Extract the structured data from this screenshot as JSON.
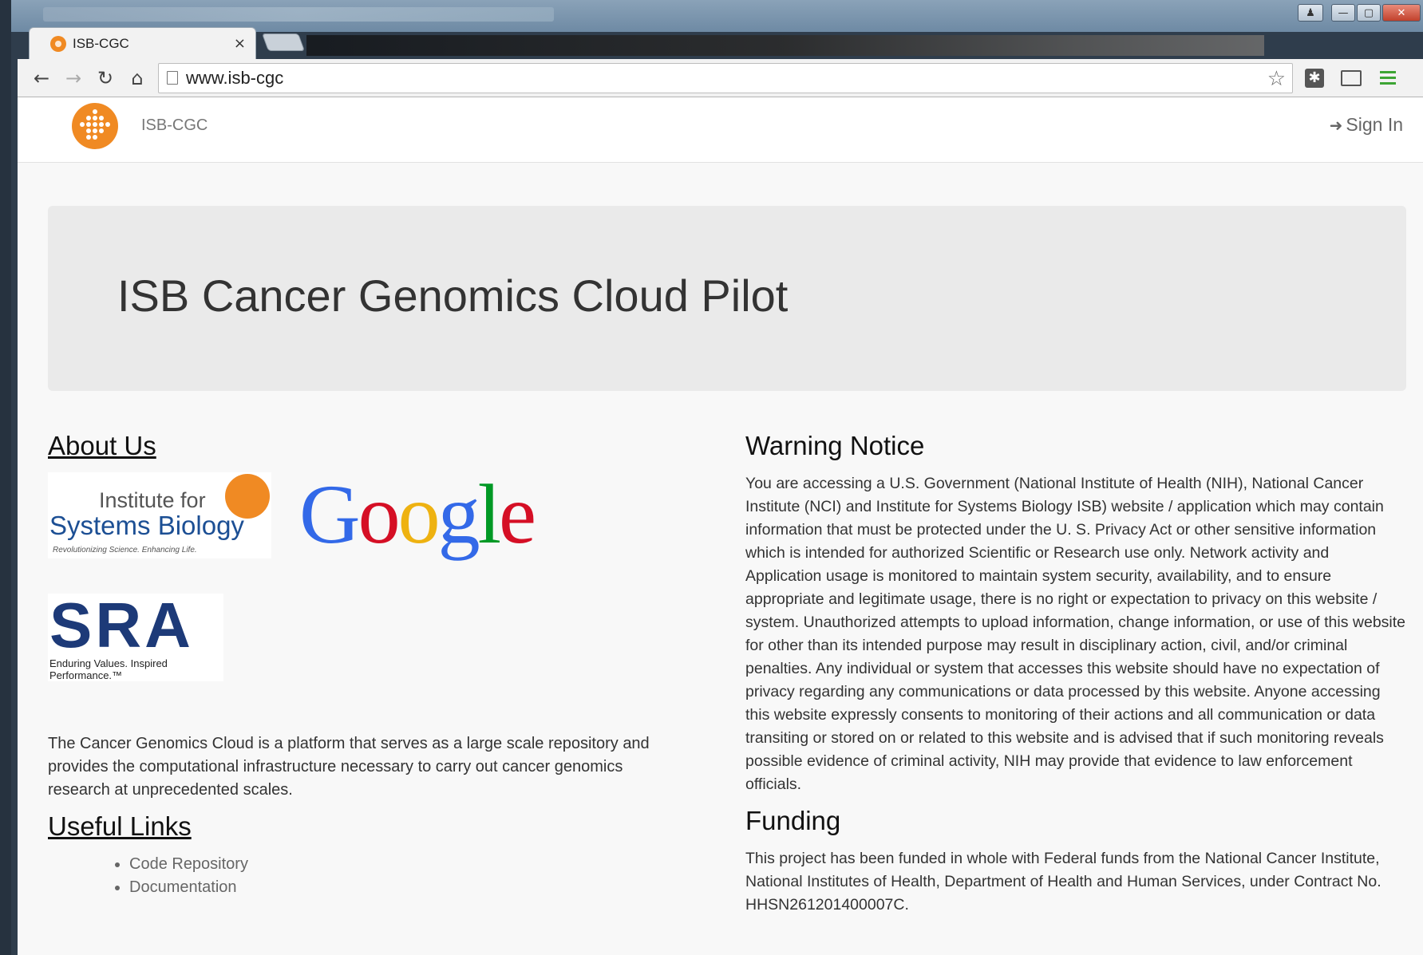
{
  "browser": {
    "tab_title": "ISB-CGC",
    "tab_close": "×",
    "url": "www.isb-cgc",
    "back": "←",
    "forward": "→",
    "reload": "↻",
    "home": "⌂",
    "star": "☆",
    "window_minimize": "—",
    "window_maximize": "▢",
    "window_close": "✕",
    "ext_puzzle": "✱"
  },
  "nav": {
    "brand": "ISB-CGC",
    "sign_in": "Sign In",
    "sign_in_icon": "➜"
  },
  "hero": {
    "title": "ISB Cancer Genomics Cloud Pilot"
  },
  "about": {
    "heading": "About Us",
    "isb_logo_line1": "Institute for",
    "isb_logo_line2": "Systems Biology",
    "isb_logo_tagline": "Revolutionizing Science. Enhancing Life.",
    "google_logo": [
      "G",
      "o",
      "o",
      "g",
      "l",
      "e"
    ],
    "sra_logo": "SRA",
    "sra_tagline": "Enduring Values. Inspired Performance.™",
    "description": "The Cancer Genomics Cloud is a platform that serves as a large scale repository and provides the computational infrastructure necessary to carry out cancer genomics research at unprecedented scales."
  },
  "useful_links": {
    "heading": "Useful Links",
    "items": [
      "Code Repository",
      "Documentation"
    ]
  },
  "warning": {
    "heading": "Warning Notice",
    "text": "You are accessing a U.S. Government (National Institute of Health (NIH), National Cancer Institute (NCI) and Institute for Systems Biology ISB) website / application which may contain information that must be protected under the U. S. Privacy Act or other sensitive information which is intended for authorized Scientific or Research use only. Network activity and Application usage is monitored to maintain system security, availability, and to ensure appropriate and legitimate usage, there is no right or expectation to privacy on this website / system. Unauthorized attempts to upload information, change information, or use of this website for other than its intended purpose may result in disciplinary action, civil, and/or criminal penalties. Any individual or system that accesses this website should have no expectation of privacy regarding any communications or data processed by this website. Anyone accessing this website expressly consents to monitoring of their actions and all communication or data transiting or stored on or related to this website and is advised that if such monitoring reveals possible evidence of criminal activity, NIH may provide that evidence to law enforcement officials."
  },
  "funding": {
    "heading": "Funding",
    "text": "This project has been funded in whole with Federal funds from the National Cancer Institute, National Institutes of Health, Department of Health and Human Services, under Contract No. HHSN261201400007C."
  },
  "colors": {
    "brand_orange": "#f08a23",
    "google_blue": "#3369e8",
    "google_red": "#d50f25",
    "google_yellow": "#eeb211",
    "google_green": "#009925",
    "sra_navy": "#1d3a78"
  }
}
